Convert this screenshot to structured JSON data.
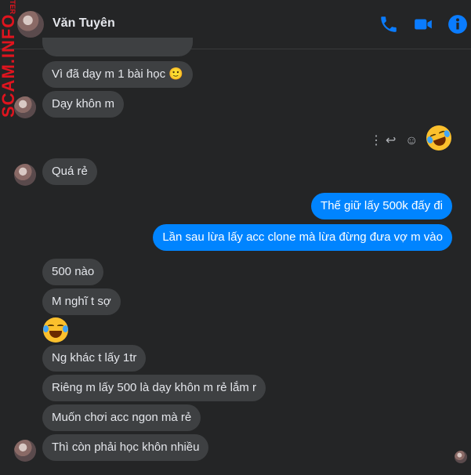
{
  "header": {
    "contact_name": "Văn Tuyên",
    "icons": [
      "phone-icon",
      "video-icon",
      "info-icon"
    ],
    "accent_color": "#0a7cff"
  },
  "watermark": {
    "top_text": "TER",
    "main_text": "SCAM.INFO",
    "color": "#e0141e"
  },
  "messages": {
    "m0": {
      "text": "Vì đã dạy m 1 bài học 🙂",
      "side": "received"
    },
    "m1": {
      "text": "Dạy khôn m",
      "side": "received"
    },
    "m2": {
      "text": "🤣",
      "side": "sent"
    },
    "m3": {
      "text": "Quá rẻ",
      "side": "received"
    },
    "m4": {
      "text": "Thế giữ lấy 500k đấy đi",
      "side": "sent"
    },
    "m5": {
      "text": "Lần sau lừa lấy acc clone mà lừa đừng đưa vợ m vào",
      "side": "sent"
    },
    "m6": {
      "text": "500 nào",
      "side": "received"
    },
    "m7": {
      "text": "M nghĩ t sợ",
      "side": "received"
    },
    "m8": {
      "text": "😂",
      "side": "received"
    },
    "m9": {
      "text": "Ng khác t lấy 1tr",
      "side": "received"
    },
    "m10": {
      "text": "Riêng m lấy 500 là dạy khôn m rẻ lắm r",
      "side": "received"
    },
    "m11": {
      "text": "Muốn chơi acc ngon mà rẻ",
      "side": "received"
    },
    "m12": {
      "text": "Thì còn phải học khôn nhiều",
      "side": "received"
    }
  },
  "colors": {
    "background": "#242526",
    "received_bubble": "#3e4042",
    "sent_bubble": "#0084ff"
  },
  "message_actions": [
    "more-icon",
    "reply-icon",
    "react-icon"
  ]
}
